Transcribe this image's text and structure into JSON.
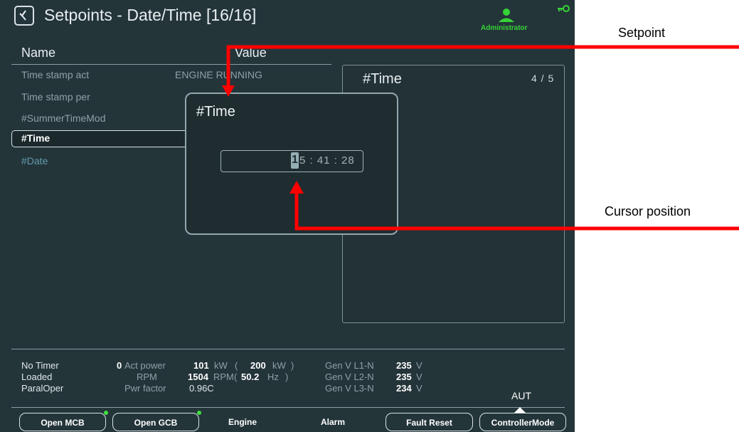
{
  "header": {
    "title": "Setpoints - Date/Time [16/16]",
    "user": "Administrator"
  },
  "columns": {
    "name": "Name",
    "value": "Value"
  },
  "rows": [
    {
      "name": "Time stamp act",
      "value": "ENGINE RUNNING"
    },
    {
      "name": "Time stamp per",
      "value": ""
    },
    {
      "name": "#SummerTimeMod",
      "value": ""
    },
    {
      "name": "#Time",
      "value": ""
    },
    {
      "name": "#Date",
      "value": ""
    }
  ],
  "help": {
    "title": "#Time",
    "page": "4 / 5"
  },
  "dialog": {
    "title": "#Time",
    "cursor_char": "1",
    "rest": "5 : 41 : 28"
  },
  "status": {
    "states": [
      "No Timer",
      "Loaded",
      "ParalOper"
    ],
    "timer_value": "0",
    "act_power": {
      "label": "Act power",
      "value": "101",
      "unit": "kW",
      "nominal": "200",
      "nominal_unit": "kW"
    },
    "rpm": {
      "label": "RPM",
      "value": "1504",
      "unit": "RPM",
      "freq": "50.2",
      "freq_unit": "Hz"
    },
    "pwr_factor": {
      "label": "Pwr factor",
      "value": "0.96C"
    },
    "gen_v": [
      {
        "label": "Gen V L1-N",
        "value": "235",
        "unit": "V"
      },
      {
        "label": "Gen V L2-N",
        "value": "235",
        "unit": "V"
      },
      {
        "label": "Gen V L3-N",
        "value": "234",
        "unit": "V"
      }
    ],
    "mode": "AUT"
  },
  "buttons": {
    "open_mcb": "Open MCB",
    "open_gcb": "Open GCB",
    "engine": "Engine",
    "alarm": "Alarm",
    "fault_reset": "Fault Reset",
    "controller_mode": "ControllerMode"
  },
  "annotations": {
    "setpoint": "Setpoint",
    "cursor": "Cursor position"
  },
  "colors": {
    "background": "#24353a",
    "annotation_arrow": "#ff0000",
    "led": "#3fe03f"
  }
}
